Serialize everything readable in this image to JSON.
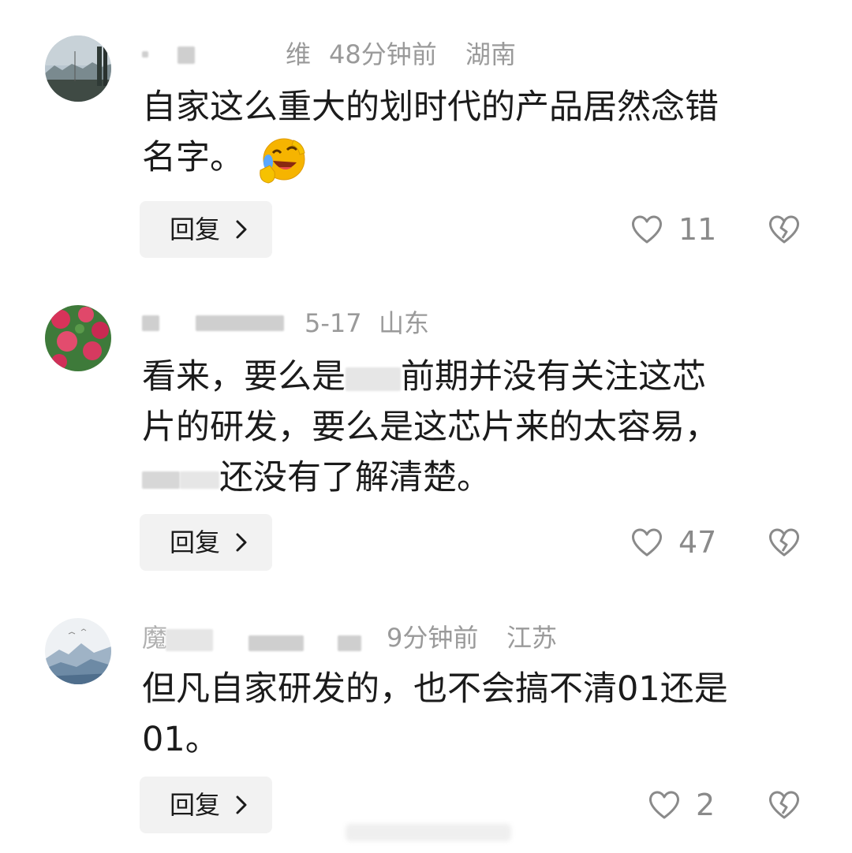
{
  "comments": [
    {
      "username_visible": "维",
      "time": "48分钟前",
      "location": "湖南",
      "lines": [
        "自家这么重大的划时代的产品居然念错",
        "名字。"
      ],
      "emoji": "laughing-crying-emoji",
      "reply_label": "回复",
      "likes": "11"
    },
    {
      "time": "5-17",
      "location": "山东",
      "lines": [
        "看来，要么是",
        "前期并没有关注这芯",
        "片的研发，要么是这芯片来的太容易，",
        "还没有了解清楚。"
      ],
      "reply_label": "回复",
      "likes": "47"
    },
    {
      "username_visible": "魔",
      "time": "9分钟前",
      "location": "江苏",
      "lines": [
        "但凡自家研发的，也不会搞不清01还是",
        "01。"
      ],
      "reply_label": "回复",
      "likes": "2"
    }
  ],
  "icons": {
    "like": "heart-outline-icon",
    "dislike": "broken-heart-icon",
    "chevron": "chevron-right-icon"
  },
  "colors": {
    "meta_text": "#9a9a9a",
    "reply_bg": "#f2f2f2",
    "body_text": "#1b1b1b"
  }
}
